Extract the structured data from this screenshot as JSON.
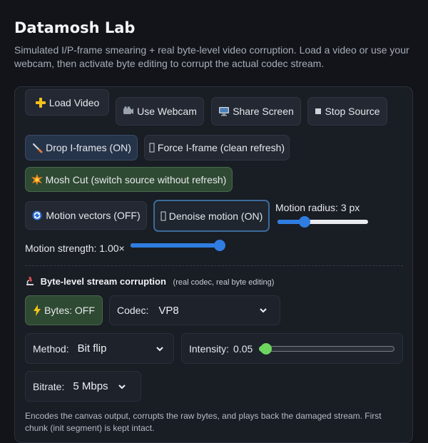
{
  "page": {
    "title": "Datamosh Lab",
    "subtitle": "Simulated I/P-frame smearing + real byte-level video corruption. Load a video or use your webcam, then activate byte editing to corrupt the actual codec stream."
  },
  "source_buttons": {
    "load_video": {
      "icon": "plus-icon",
      "label": "Load Video"
    },
    "use_webcam": {
      "icon": "camera-icon",
      "label": "Use Webcam"
    },
    "share_screen": {
      "icon": "monitor-icon",
      "label": "Share Screen"
    },
    "stop_source": {
      "icon": "stop-icon",
      "label": "Stop Source"
    }
  },
  "frame_controls": {
    "drop_iframes": {
      "icon": "brush-icon",
      "label": "Drop I-frames (ON)"
    },
    "force_iframe": {
      "icon": "refresh-icon",
      "label": "Force I-frame (clean refresh)"
    },
    "mosh_cut": {
      "icon": "explosion-icon",
      "label": "Mosh Cut (switch source without refresh)"
    }
  },
  "motion": {
    "vectors_button": {
      "icon": "cycle-icon",
      "label": "Motion vectors (OFF)"
    },
    "denoise_button": {
      "icon": "sparkle-icon",
      "label": "Denoise motion (ON)"
    },
    "radius_label": "Motion radius: 3 px",
    "radius_value": 0.3,
    "strength_label": "Motion strength: 1.00×",
    "strength_value": 1.0
  },
  "byte_section": {
    "icon": "microscope-icon",
    "title": "Byte-level stream corruption",
    "note": "(real codec, real byte editing)",
    "bytes_button": {
      "icon": "bolt-icon",
      "label": "Bytes: OFF"
    },
    "codec": {
      "label": "Codec:",
      "value": "VP8"
    },
    "method": {
      "label": "Method:",
      "value": "Bit flip"
    },
    "intensity": {
      "label": "Intensity:",
      "value_text": "0.05",
      "value": 0.05
    },
    "bitrate": {
      "label": "Bitrate:",
      "value": "5 Mbps"
    },
    "footnote": "Encodes the canvas output, corrupts the raw bytes, and plays back the damaged stream. First chunk (init segment) is kept intact."
  }
}
